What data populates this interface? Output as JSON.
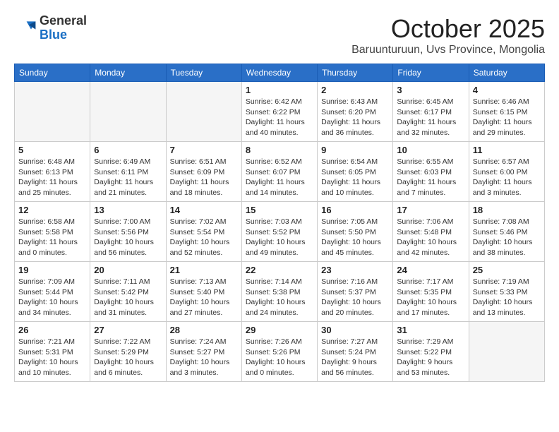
{
  "logo": {
    "general": "General",
    "blue": "Blue"
  },
  "title": "October 2025",
  "subtitle": "Baruunturuun, Uvs Province, Mongolia",
  "headers": [
    "Sunday",
    "Monday",
    "Tuesday",
    "Wednesday",
    "Thursday",
    "Friday",
    "Saturday"
  ],
  "weeks": [
    [
      {
        "day": "",
        "sunrise": "",
        "sunset": "",
        "daylight": ""
      },
      {
        "day": "",
        "sunrise": "",
        "sunset": "",
        "daylight": ""
      },
      {
        "day": "",
        "sunrise": "",
        "sunset": "",
        "daylight": ""
      },
      {
        "day": "1",
        "sunrise": "Sunrise: 6:42 AM",
        "sunset": "Sunset: 6:22 PM",
        "daylight": "Daylight: 11 hours and 40 minutes."
      },
      {
        "day": "2",
        "sunrise": "Sunrise: 6:43 AM",
        "sunset": "Sunset: 6:20 PM",
        "daylight": "Daylight: 11 hours and 36 minutes."
      },
      {
        "day": "3",
        "sunrise": "Sunrise: 6:45 AM",
        "sunset": "Sunset: 6:17 PM",
        "daylight": "Daylight: 11 hours and 32 minutes."
      },
      {
        "day": "4",
        "sunrise": "Sunrise: 6:46 AM",
        "sunset": "Sunset: 6:15 PM",
        "daylight": "Daylight: 11 hours and 29 minutes."
      }
    ],
    [
      {
        "day": "5",
        "sunrise": "Sunrise: 6:48 AM",
        "sunset": "Sunset: 6:13 PM",
        "daylight": "Daylight: 11 hours and 25 minutes."
      },
      {
        "day": "6",
        "sunrise": "Sunrise: 6:49 AM",
        "sunset": "Sunset: 6:11 PM",
        "daylight": "Daylight: 11 hours and 21 minutes."
      },
      {
        "day": "7",
        "sunrise": "Sunrise: 6:51 AM",
        "sunset": "Sunset: 6:09 PM",
        "daylight": "Daylight: 11 hours and 18 minutes."
      },
      {
        "day": "8",
        "sunrise": "Sunrise: 6:52 AM",
        "sunset": "Sunset: 6:07 PM",
        "daylight": "Daylight: 11 hours and 14 minutes."
      },
      {
        "day": "9",
        "sunrise": "Sunrise: 6:54 AM",
        "sunset": "Sunset: 6:05 PM",
        "daylight": "Daylight: 11 hours and 10 minutes."
      },
      {
        "day": "10",
        "sunrise": "Sunrise: 6:55 AM",
        "sunset": "Sunset: 6:03 PM",
        "daylight": "Daylight: 11 hours and 7 minutes."
      },
      {
        "day": "11",
        "sunrise": "Sunrise: 6:57 AM",
        "sunset": "Sunset: 6:00 PM",
        "daylight": "Daylight: 11 hours and 3 minutes."
      }
    ],
    [
      {
        "day": "12",
        "sunrise": "Sunrise: 6:58 AM",
        "sunset": "Sunset: 5:58 PM",
        "daylight": "Daylight: 11 hours and 0 minutes."
      },
      {
        "day": "13",
        "sunrise": "Sunrise: 7:00 AM",
        "sunset": "Sunset: 5:56 PM",
        "daylight": "Daylight: 10 hours and 56 minutes."
      },
      {
        "day": "14",
        "sunrise": "Sunrise: 7:02 AM",
        "sunset": "Sunset: 5:54 PM",
        "daylight": "Daylight: 10 hours and 52 minutes."
      },
      {
        "day": "15",
        "sunrise": "Sunrise: 7:03 AM",
        "sunset": "Sunset: 5:52 PM",
        "daylight": "Daylight: 10 hours and 49 minutes."
      },
      {
        "day": "16",
        "sunrise": "Sunrise: 7:05 AM",
        "sunset": "Sunset: 5:50 PM",
        "daylight": "Daylight: 10 hours and 45 minutes."
      },
      {
        "day": "17",
        "sunrise": "Sunrise: 7:06 AM",
        "sunset": "Sunset: 5:48 PM",
        "daylight": "Daylight: 10 hours and 42 minutes."
      },
      {
        "day": "18",
        "sunrise": "Sunrise: 7:08 AM",
        "sunset": "Sunset: 5:46 PM",
        "daylight": "Daylight: 10 hours and 38 minutes."
      }
    ],
    [
      {
        "day": "19",
        "sunrise": "Sunrise: 7:09 AM",
        "sunset": "Sunset: 5:44 PM",
        "daylight": "Daylight: 10 hours and 34 minutes."
      },
      {
        "day": "20",
        "sunrise": "Sunrise: 7:11 AM",
        "sunset": "Sunset: 5:42 PM",
        "daylight": "Daylight: 10 hours and 31 minutes."
      },
      {
        "day": "21",
        "sunrise": "Sunrise: 7:13 AM",
        "sunset": "Sunset: 5:40 PM",
        "daylight": "Daylight: 10 hours and 27 minutes."
      },
      {
        "day": "22",
        "sunrise": "Sunrise: 7:14 AM",
        "sunset": "Sunset: 5:38 PM",
        "daylight": "Daylight: 10 hours and 24 minutes."
      },
      {
        "day": "23",
        "sunrise": "Sunrise: 7:16 AM",
        "sunset": "Sunset: 5:37 PM",
        "daylight": "Daylight: 10 hours and 20 minutes."
      },
      {
        "day": "24",
        "sunrise": "Sunrise: 7:17 AM",
        "sunset": "Sunset: 5:35 PM",
        "daylight": "Daylight: 10 hours and 17 minutes."
      },
      {
        "day": "25",
        "sunrise": "Sunrise: 7:19 AM",
        "sunset": "Sunset: 5:33 PM",
        "daylight": "Daylight: 10 hours and 13 minutes."
      }
    ],
    [
      {
        "day": "26",
        "sunrise": "Sunrise: 7:21 AM",
        "sunset": "Sunset: 5:31 PM",
        "daylight": "Daylight: 10 hours and 10 minutes."
      },
      {
        "day": "27",
        "sunrise": "Sunrise: 7:22 AM",
        "sunset": "Sunset: 5:29 PM",
        "daylight": "Daylight: 10 hours and 6 minutes."
      },
      {
        "day": "28",
        "sunrise": "Sunrise: 7:24 AM",
        "sunset": "Sunset: 5:27 PM",
        "daylight": "Daylight: 10 hours and 3 minutes."
      },
      {
        "day": "29",
        "sunrise": "Sunrise: 7:26 AM",
        "sunset": "Sunset: 5:26 PM",
        "daylight": "Daylight: 10 hours and 0 minutes."
      },
      {
        "day": "30",
        "sunrise": "Sunrise: 7:27 AM",
        "sunset": "Sunset: 5:24 PM",
        "daylight": "Daylight: 9 hours and 56 minutes."
      },
      {
        "day": "31",
        "sunrise": "Sunrise: 7:29 AM",
        "sunset": "Sunset: 5:22 PM",
        "daylight": "Daylight: 9 hours and 53 minutes."
      },
      {
        "day": "",
        "sunrise": "",
        "sunset": "",
        "daylight": ""
      }
    ]
  ]
}
